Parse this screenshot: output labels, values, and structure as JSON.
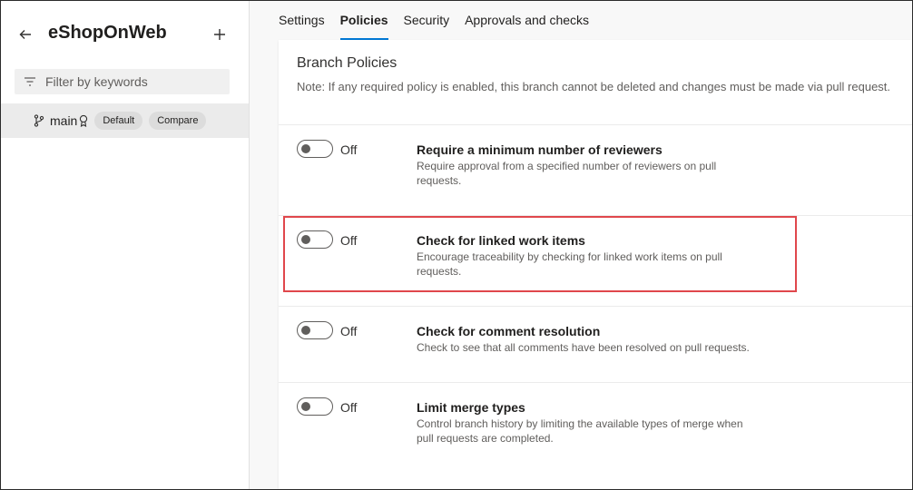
{
  "sidebar": {
    "repo_name": "eShopOnWeb",
    "back_icon": "arrow-left-icon",
    "add_icon": "plus-icon",
    "filter": {
      "placeholder": "Filter by keywords",
      "value": ""
    },
    "branch": {
      "name": "main",
      "badges": [
        "Default",
        "Compare"
      ]
    }
  },
  "tabs": [
    {
      "label": "Settings",
      "active": false
    },
    {
      "label": "Policies",
      "active": true
    },
    {
      "label": "Security",
      "active": false
    },
    {
      "label": "Approvals and checks",
      "active": false
    }
  ],
  "branch_policies": {
    "title": "Branch Policies",
    "note": "Note: If any required policy is enabled, this branch cannot be deleted and changes must be made via pull request.",
    "policies": [
      {
        "state": "Off",
        "title": "Require a minimum number of reviewers",
        "description": "Require approval from a specified number of reviewers on pull requests."
      },
      {
        "state": "Off",
        "title": "Check for linked work items",
        "description": "Encourage traceability by checking for linked work items on pull requests."
      },
      {
        "state": "Off",
        "title": "Check for comment resolution",
        "description": "Check to see that all comments have been resolved on pull requests."
      },
      {
        "state": "Off",
        "title": "Limit merge types",
        "description": "Control branch history by limiting the available types of merge when pull requests are completed."
      }
    ]
  },
  "colors": {
    "accent": "#0078d4",
    "highlight": "#e0474c"
  }
}
